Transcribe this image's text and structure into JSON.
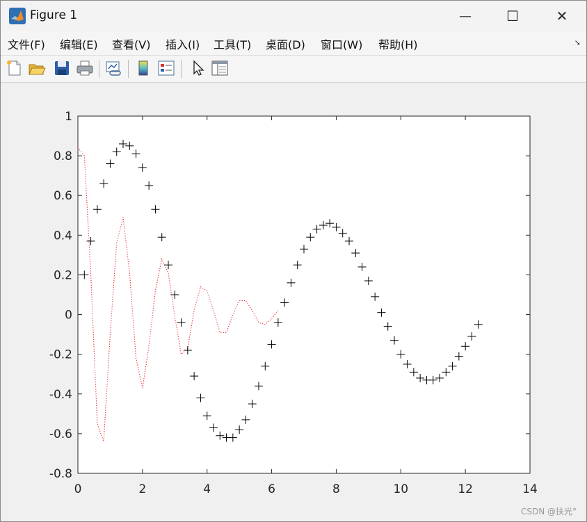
{
  "window": {
    "title": "Figure 1",
    "controls": {
      "minimize": "—",
      "maximize": "☐",
      "close": "✕"
    }
  },
  "menu": {
    "items": [
      "文件(F)",
      "编辑(E)",
      "查看(V)",
      "插入(I)",
      "工具(T)",
      "桌面(D)",
      "窗口(W)",
      "帮助(H)"
    ],
    "corner_glyph": "➘"
  },
  "toolbar": {
    "icons": [
      "new-figure-icon",
      "open-file-icon",
      "save-icon",
      "print-icon",
      "link-plot-icon",
      "insert-colorbar-icon",
      "insert-legend-icon",
      "pointer-icon",
      "property-editor-icon"
    ]
  },
  "watermark": "CSDN @扶光°",
  "chart_data": {
    "type": "scatter",
    "title": "",
    "xlabel": "",
    "ylabel": "",
    "xlim": [
      0,
      14
    ],
    "ylim": [
      -0.8,
      1
    ],
    "xticks": [
      "0",
      "2",
      "4",
      "6",
      "8",
      "10",
      "12",
      "14"
    ],
    "yticks": [
      "1",
      "0.8",
      "0.6",
      "0.4",
      "0.2",
      "0",
      "-0.2",
      "-0.4",
      "-0.6",
      "-0.8"
    ],
    "grid": false,
    "series": [
      {
        "style": "dotted-line",
        "color": "#e8262a",
        "x": [
          0,
          0.2,
          0.4,
          0.6,
          0.8,
          1.0,
          1.2,
          1.4,
          1.6,
          1.8,
          2.0,
          2.2,
          2.4,
          2.6,
          2.8,
          3.0,
          3.2,
          3.4,
          3.6,
          3.8,
          4.0,
          4.2,
          4.4,
          4.6,
          4.8,
          5.0,
          5.2,
          5.4,
          5.6,
          5.8,
          6.0,
          6.2
        ],
        "y": [
          0.84,
          0.8,
          0.2,
          -0.55,
          -0.64,
          -0.1,
          0.36,
          0.49,
          0.21,
          -0.22,
          -0.37,
          -0.16,
          0.12,
          0.28,
          0.21,
          -0.01,
          -0.2,
          -0.17,
          0.02,
          0.14,
          0.12,
          0.02,
          -0.09,
          -0.09,
          0.0,
          0.07,
          0.07,
          0.02,
          -0.04,
          -0.05,
          -0.02,
          0.02
        ]
      },
      {
        "style": "plus-markers",
        "color": "#000000",
        "x": [
          0.2,
          0.4,
          0.6,
          0.8,
          1.0,
          1.2,
          1.4,
          1.6,
          1.8,
          2.0,
          2.2,
          2.4,
          2.6,
          2.8,
          3.0,
          3.2,
          3.4,
          3.6,
          3.8,
          4.0,
          4.2,
          4.4,
          4.6,
          4.8,
          5.0,
          5.2,
          5.4,
          5.6,
          5.8,
          6.0,
          6.2,
          6.4,
          6.6,
          6.8,
          7.0,
          7.2,
          7.4,
          7.6,
          7.8,
          8.0,
          8.2,
          8.4,
          8.6,
          8.8,
          9.0,
          9.2,
          9.4,
          9.6,
          9.8,
          10.0,
          10.2,
          10.4,
          10.6,
          10.8,
          11.0,
          11.2,
          11.4,
          11.6,
          11.8,
          12.0,
          12.2,
          12.4
        ],
        "y": [
          0.2,
          0.37,
          0.53,
          0.66,
          0.76,
          0.82,
          0.86,
          0.85,
          0.81,
          0.74,
          0.65,
          0.53,
          0.39,
          0.25,
          0.1,
          -0.04,
          -0.18,
          -0.31,
          -0.42,
          -0.51,
          -0.57,
          -0.61,
          -0.62,
          -0.62,
          -0.58,
          -0.53,
          -0.45,
          -0.36,
          -0.26,
          -0.15,
          -0.04,
          0.06,
          0.16,
          0.25,
          0.33,
          0.39,
          0.43,
          0.45,
          0.46,
          0.44,
          0.41,
          0.37,
          0.31,
          0.24,
          0.17,
          0.09,
          0.01,
          -0.06,
          -0.13,
          -0.2,
          -0.25,
          -0.29,
          -0.32,
          -0.33,
          -0.33,
          -0.32,
          -0.29,
          -0.26,
          -0.21,
          -0.16,
          -0.11,
          -0.05
        ]
      }
    ]
  }
}
